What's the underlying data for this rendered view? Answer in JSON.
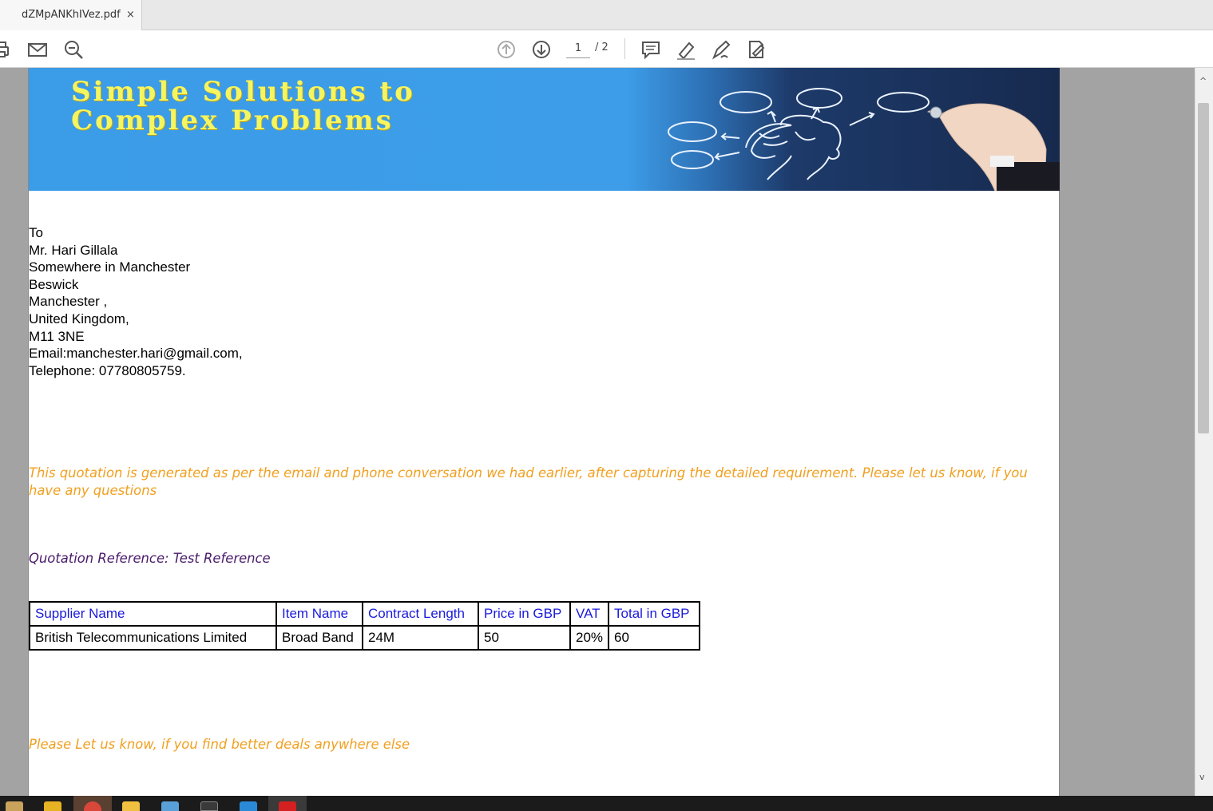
{
  "tab": {
    "title": "dZMpANKhIVez.pdf",
    "close_glyph": "×"
  },
  "toolbar": {
    "page_current": "1",
    "page_total": "/ 2",
    "icons": [
      "print-icon",
      "email-icon",
      "zoom-icon",
      "page-up-icon",
      "page-down-icon",
      "comment-icon",
      "highlight-icon",
      "sign-icon",
      "edit-pdf-icon"
    ]
  },
  "banner": {
    "line1": "Simple Solutions to",
    "line2": "Complex Problems"
  },
  "address": {
    "lines": [
      "To",
      "Mr. Hari Gillala",
      "Somewhere in Manchester",
      "Beswick",
      "Manchester ,",
      "United Kingdom,",
      "M11 3NE",
      "Email:manchester.hari@gmail.com,",
      "Telephone: 07780805759."
    ]
  },
  "intro_text": "This quotation is generated as per the email and phone conversation we had earlier, after capturing the detailed requirement. Please let us know, if you have any questions",
  "quote_reference": "Quotation Reference: Test Reference",
  "table": {
    "headers": [
      "Supplier Name",
      "Item Name",
      "Contract Length",
      "Price in GBP",
      "VAT",
      "Total in GBP"
    ],
    "rows": [
      [
        "British Telecommunications Limited",
        "Broad Band",
        "24M",
        "50",
        "20%",
        "60"
      ]
    ]
  },
  "outro_text": "Please Let us know, if you find better deals anywhere else",
  "scrollbar": {
    "up_glyph": "^",
    "down_glyph": "v"
  },
  "colors": {
    "banner_blue": "#3b9ce8",
    "banner_text": "#f5f560",
    "orange_text": "#f0a020",
    "purple_text": "#4a1a6a",
    "table_header": "#1a1adc"
  },
  "taskbar": {
    "icons": [
      "paint-icon",
      "mail-app-icon",
      "chrome-icon",
      "file-explorer-icon",
      "photos-icon",
      "terminal-icon",
      "vscode-icon",
      "acrobat-icon"
    ]
  }
}
